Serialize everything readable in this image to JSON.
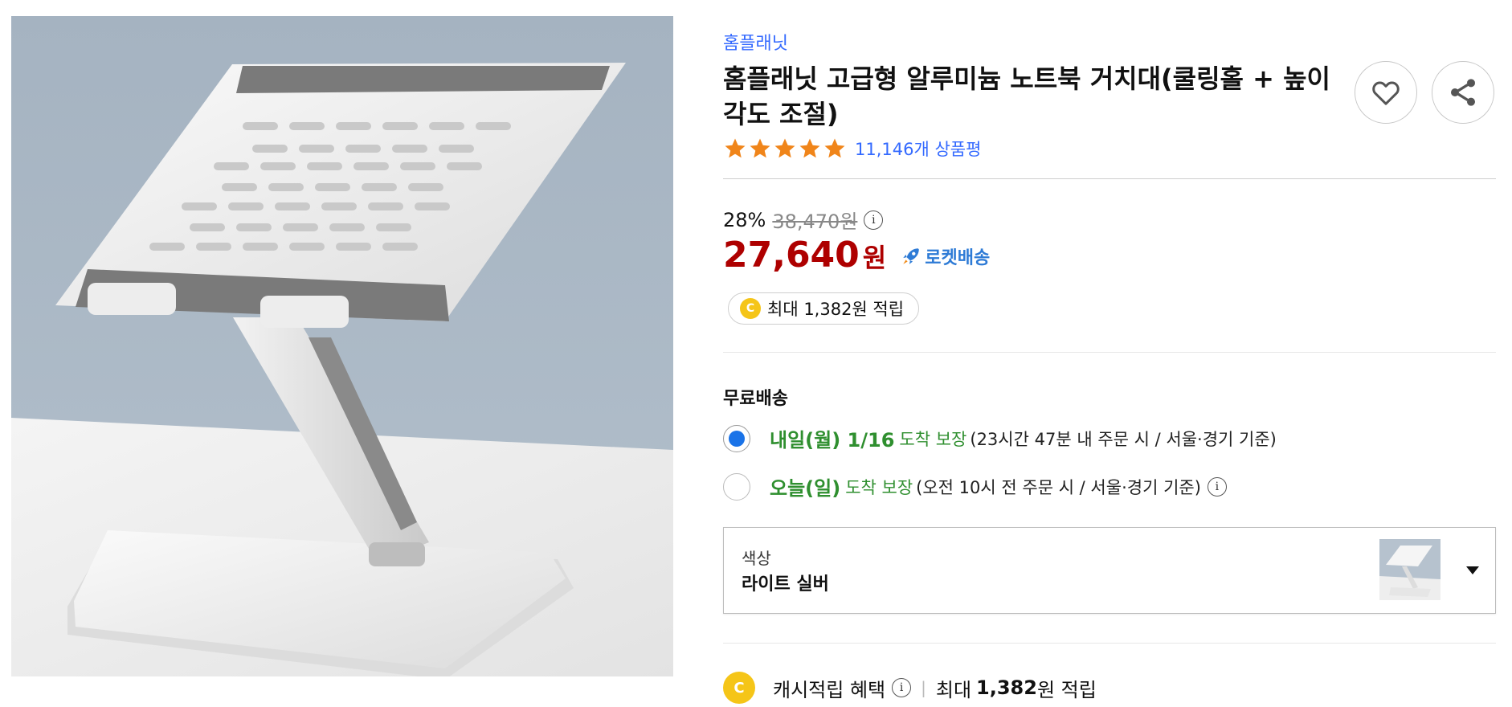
{
  "product": {
    "brand": "홈플래닛",
    "title": "홈플래닛 고급형 알루미늄 노트북 거치대(쿨링홀 + 높이 각도 조절)",
    "rating_stars": 5,
    "review_count": "11,146개 상품평"
  },
  "actions": {
    "wishlist_icon": "heart-icon",
    "share_icon": "share-icon"
  },
  "price": {
    "discount_rate": "28%",
    "original_price": "38,470원",
    "sale_price": "27,640",
    "currency": "원",
    "delivery_badge": "로켓배송"
  },
  "reward": {
    "coin_label": "C",
    "text": "최대 1,382원 적립"
  },
  "shipping": {
    "title": "무료배송",
    "options": [
      {
        "date": "내일(월) 1/16",
        "guarantee": "도착 보장",
        "note": "(23시간 47분 내 주문 시 / 서울·경기 기준)",
        "selected": true
      },
      {
        "date": "오늘(일)",
        "guarantee": "도착 보장",
        "note": "(오전 10시 전 주문 시 / 서울·경기 기준)",
        "selected": false
      }
    ]
  },
  "option_select": {
    "label": "색상",
    "value": "라이트 실버"
  },
  "cash_benefit": {
    "label": "캐시적립 혜택",
    "prefix": "최대",
    "amount": "1,382",
    "suffix": "원 적립"
  },
  "colors": {
    "brand_blue": "#346aff",
    "price_red": "#ae0000",
    "green": "#2f8f2f",
    "star": "#f0851a",
    "coin": "#f5c518"
  }
}
